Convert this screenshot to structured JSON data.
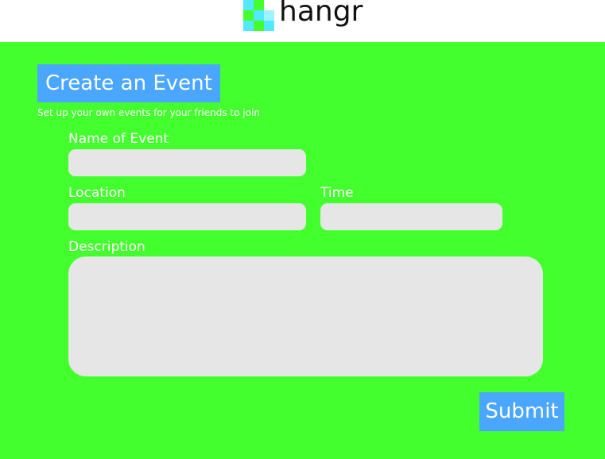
{
  "header": {
    "logo_text": "hangr",
    "logo_icon": "checker-logo-icon",
    "logo_colors": {
      "cyan": "#52e8ff",
      "green": "#44ff2e",
      "light_cyan": "#9cf3ff"
    }
  },
  "main": {
    "title": "Create an Event",
    "subtitle": "Set up your own events for your friends to join"
  },
  "form": {
    "name_label": "Name of Event",
    "name_value": "",
    "location_label": "Location",
    "location_value": "",
    "time_label": "Time",
    "time_value": "",
    "description_label": "Description",
    "description_value": "",
    "submit_label": "Submit"
  },
  "colors": {
    "background": "#44ff2e",
    "accent": "#4aa6ff",
    "field": "#e6e6e6",
    "header": "#ffffff"
  }
}
